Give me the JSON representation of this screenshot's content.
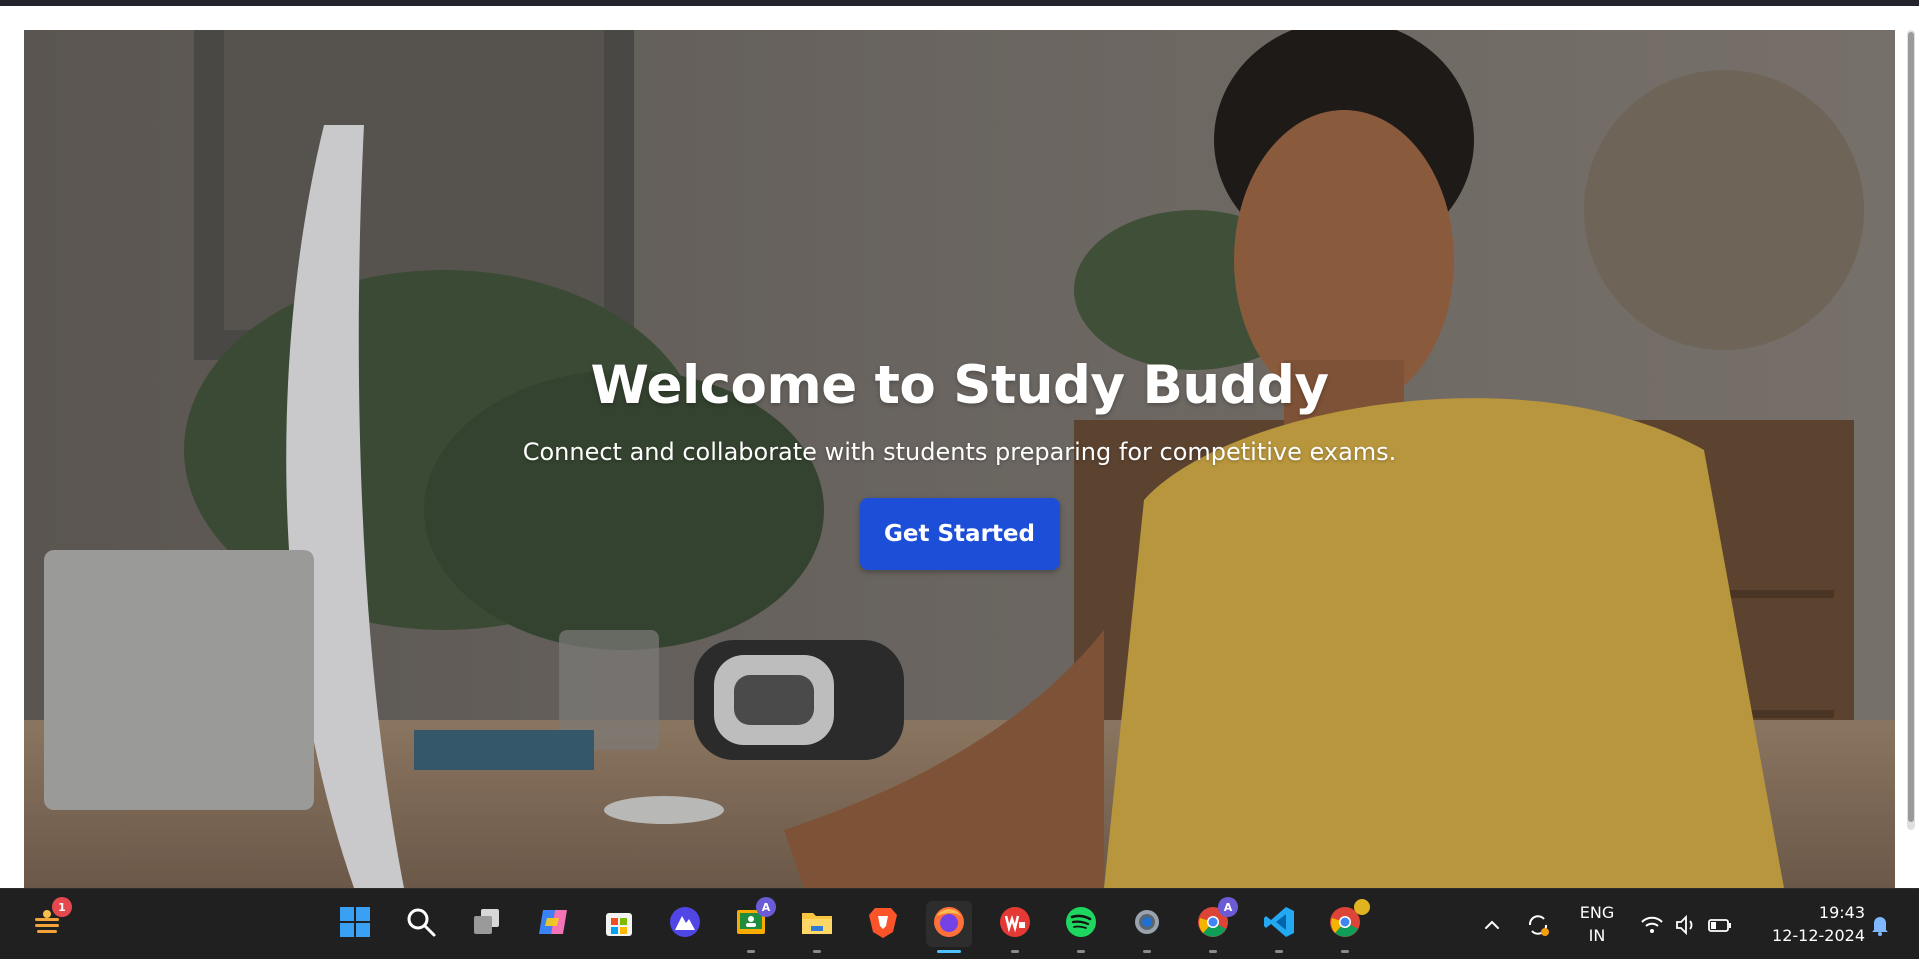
{
  "hero": {
    "title": "Welcome to Study Buddy",
    "subtitle": "Connect and collaborate with students preparing for competitive exams.",
    "cta_label": "Get Started"
  },
  "taskbar": {
    "widgets_badge": "1",
    "apps": [
      {
        "name": "start",
        "icon": "windows-logo-icon"
      },
      {
        "name": "search",
        "icon": "search-icon"
      },
      {
        "name": "task-view",
        "icon": "task-view-icon"
      },
      {
        "name": "copilot",
        "icon": "copilot-icon"
      },
      {
        "name": "microsoft-store",
        "icon": "store-icon"
      },
      {
        "name": "app-a",
        "icon": "mountain-app-icon"
      },
      {
        "name": "classroom",
        "icon": "classroom-icon",
        "badge": "A"
      },
      {
        "name": "file-explorer",
        "icon": "folder-icon"
      },
      {
        "name": "brave",
        "icon": "brave-icon"
      },
      {
        "name": "firefox",
        "icon": "firefox-icon"
      },
      {
        "name": "wps-office",
        "icon": "wps-icon"
      },
      {
        "name": "spotify",
        "icon": "spotify-icon"
      },
      {
        "name": "settings",
        "icon": "gear-icon"
      },
      {
        "name": "chrome-profile-a",
        "icon": "chrome-icon",
        "badge": "A"
      },
      {
        "name": "vscode",
        "icon": "vscode-icon"
      },
      {
        "name": "chrome",
        "icon": "chrome-icon"
      }
    ],
    "language": "ENG",
    "region": "IN",
    "time": "19:43",
    "date": "12-12-2024"
  },
  "colors": {
    "button": "#1d4ed8",
    "taskbar": "#202020",
    "active_indicator": "#4cc2ff"
  }
}
